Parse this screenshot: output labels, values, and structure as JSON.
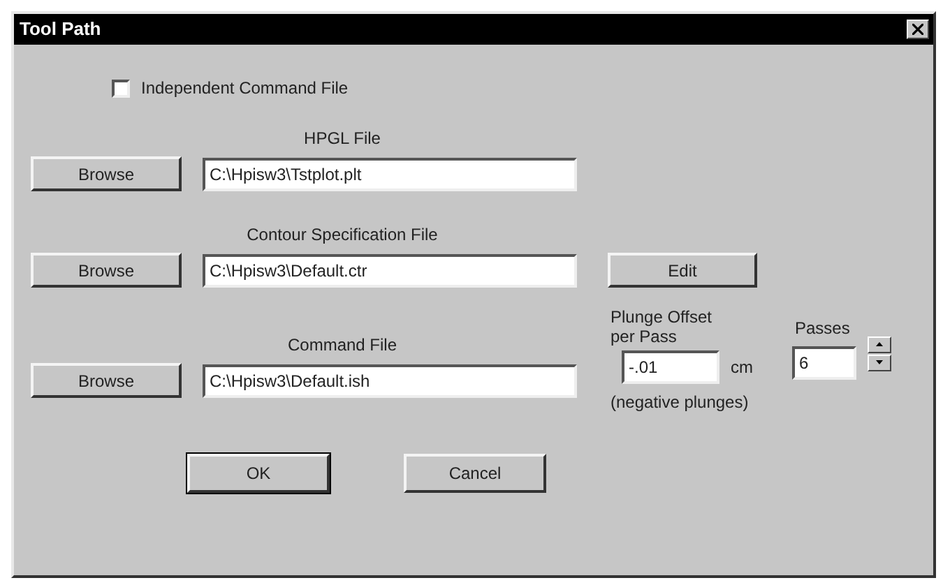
{
  "window": {
    "title": "Tool Path"
  },
  "independent_command_file": {
    "label": "Independent Command File",
    "checked": false
  },
  "files": [
    {
      "label": "HPGL File",
      "button": "Browse",
      "value": "C:\\Hpisw3\\Tstplot.plt"
    },
    {
      "label": "Contour Specification File",
      "button": "Browse",
      "value": "C:\\Hpisw3\\Default.ctr",
      "edit_button": "Edit"
    },
    {
      "label": "Command File",
      "button": "Browse",
      "value": "C:\\Hpisw3\\Default.ish"
    }
  ],
  "plunge_offset": {
    "label": "Plunge Offset per Pass",
    "value": "-.01",
    "unit": "cm",
    "note": "(negative plunges)"
  },
  "passes": {
    "label": "Passes",
    "value": "6"
  },
  "buttons": [
    {
      "label": "OK",
      "default": true
    },
    {
      "label": "Cancel",
      "default": false
    }
  ]
}
